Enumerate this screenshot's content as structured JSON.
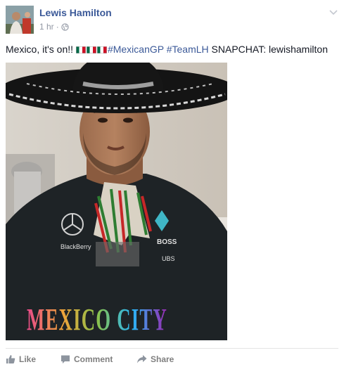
{
  "post": {
    "author": "Lewis Hamilton",
    "time": "1 hr",
    "separator": "·",
    "privacy_icon": "globe-icon",
    "options_icon": "chevron-down-icon",
    "text_prefix": "Mexico, it's on!! ",
    "hashtag_1": "#MexicanGP",
    "hashtag_2": "#TeamLH",
    "text_suffix": " SNAPCHAT: lewishamilton",
    "flag_icon": "mexico-flag-icon",
    "photo": {
      "subject": "Lewis Hamilton wearing a sombrero and Mercedes team shirt",
      "overlay_text": "MEXICO CITY",
      "shirt_text_1": "BlackBerry",
      "shirt_text_2": "BOSS",
      "shirt_text_3": "UBS"
    }
  },
  "actions": [
    {
      "label": "Like",
      "icon": "thumbs-up-icon"
    },
    {
      "label": "Comment",
      "icon": "comment-icon"
    },
    {
      "label": "Share",
      "icon": "share-icon"
    }
  ],
  "colors": {
    "link": "#3b5998",
    "meta": "#9197a3",
    "action": "#7f7f7f"
  }
}
